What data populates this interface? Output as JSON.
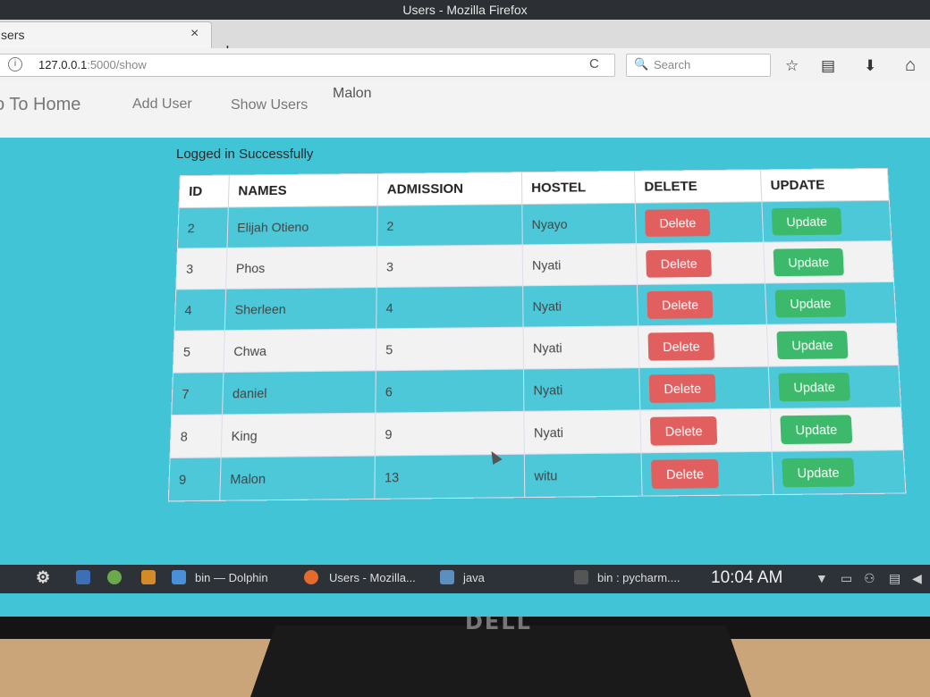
{
  "window": {
    "title": "Users - Mozilla Firefox"
  },
  "tab": {
    "title": "sers",
    "close": "×",
    "new_tab": "+"
  },
  "address_bar": {
    "url_main": "127.0.0.1",
    "url_rest": ":5000/show",
    "info": "i"
  },
  "search": {
    "placeholder": "Search"
  },
  "toolbar": {
    "reload": "C",
    "bookmark": "☆",
    "reader": "▤",
    "download": "⬇",
    "home": "⌂"
  },
  "site_nav": {
    "home": "o To Home",
    "add_user": "Add User",
    "show_users": "Show Users",
    "username": "Malon"
  },
  "message": "Logged in Successfully",
  "table": {
    "headers": [
      "ID",
      "NAMES",
      "ADMISSION",
      "HOSTEL",
      "DELETE",
      "UPDATE"
    ],
    "rows": [
      {
        "id": "2",
        "name": "Elijah Otieno",
        "admission": "2",
        "hostel": "Nyayo"
      },
      {
        "id": "3",
        "name": "Phos",
        "admission": "3",
        "hostel": "Nyati"
      },
      {
        "id": "4",
        "name": "Sherleen",
        "admission": "4",
        "hostel": "Nyati"
      },
      {
        "id": "5",
        "name": "Chwa",
        "admission": "5",
        "hostel": "Nyati"
      },
      {
        "id": "7",
        "name": "daniel",
        "admission": "6",
        "hostel": "Nyati"
      },
      {
        "id": "8",
        "name": "King",
        "admission": "9",
        "hostel": "Nyati"
      },
      {
        "id": "9",
        "name": "Malon",
        "admission": "13",
        "hostel": "witu"
      }
    ],
    "delete_label": "Delete",
    "update_label": "Update"
  },
  "taskbar": {
    "apps": [
      {
        "label": "bin — Dolphin",
        "icon": "folder-icon"
      },
      {
        "label": "Users - Mozilla...",
        "icon": "firefox-icon"
      },
      {
        "label": "java",
        "icon": "java-icon"
      },
      {
        "label": "bin : pycharm....",
        "icon": "terminal-icon"
      }
    ],
    "clock": "10:04 AM"
  },
  "colors": {
    "page_bg": "#40c4d6",
    "row_odd": "#4cc8d8",
    "row_even": "#f2f2f2",
    "delete": "#e25f5f",
    "update": "#3db96b"
  }
}
